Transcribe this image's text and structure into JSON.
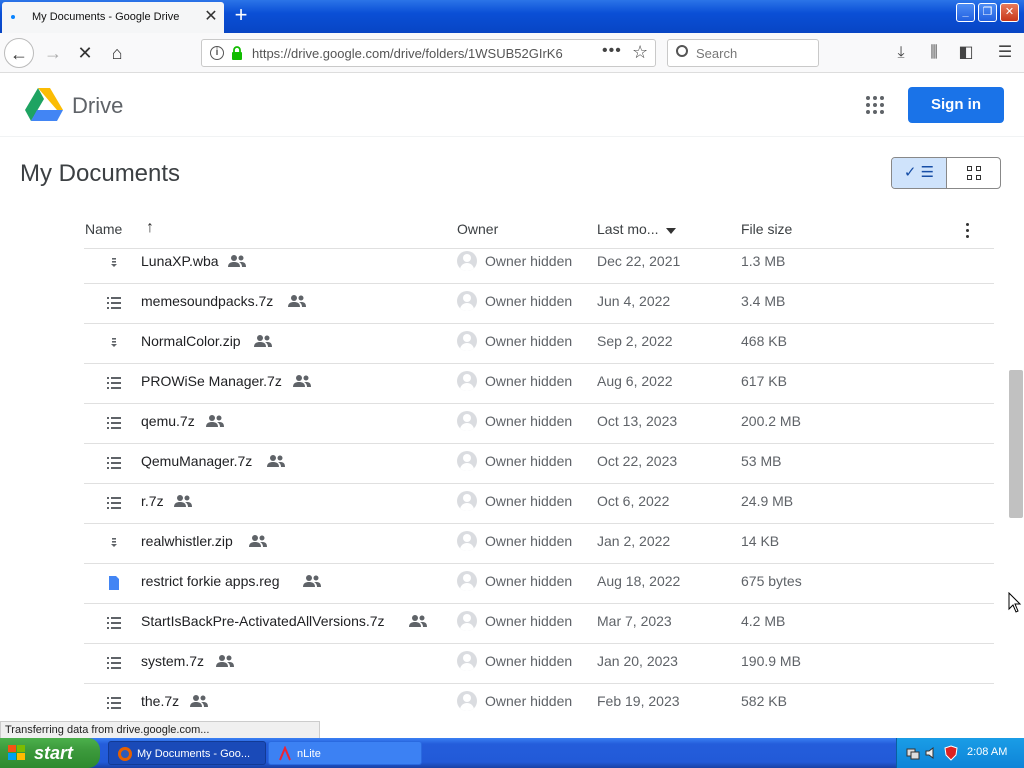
{
  "browser": {
    "tab_title": "My Documents - Google Drive",
    "url": "https://drive.google.com/drive/folders/1WSUB52GIrK6",
    "search_placeholder": "Search",
    "status_text": "Transferring data from drive.google.com..."
  },
  "drive": {
    "product_name": "Drive",
    "signin_label": "Sign in",
    "page_title": "My Documents",
    "columns": {
      "name": "Name",
      "owner": "Owner",
      "modified": "Last mo...",
      "size": "File size"
    },
    "files": [
      {
        "name": "LunaXP.wba",
        "icon": "archive-icon",
        "owner": "Owner hidden",
        "date": "Dec 22, 2021",
        "size": "1.3 MB"
      },
      {
        "name": "memesoundpacks.7z",
        "icon": "list-icon",
        "owner": "Owner hidden",
        "date": "Jun 4, 2022",
        "size": "3.4 MB"
      },
      {
        "name": "NormalColor.zip",
        "icon": "archive-icon",
        "owner": "Owner hidden",
        "date": "Sep 2, 2022",
        "size": "468 KB"
      },
      {
        "name": "PROWiSe Manager.7z",
        "icon": "list-icon",
        "owner": "Owner hidden",
        "date": "Aug 6, 2022",
        "size": "617 KB"
      },
      {
        "name": "qemu.7z",
        "icon": "list-icon",
        "owner": "Owner hidden",
        "date": "Oct 13, 2023",
        "size": "200.2 MB"
      },
      {
        "name": "QemuManager.7z",
        "icon": "list-icon",
        "owner": "Owner hidden",
        "date": "Oct 22, 2023",
        "size": "53 MB"
      },
      {
        "name": "r.7z",
        "icon": "list-icon",
        "owner": "Owner hidden",
        "date": "Oct 6, 2022",
        "size": "24.9 MB"
      },
      {
        "name": "realwhistler.zip",
        "icon": "archive-icon",
        "owner": "Owner hidden",
        "date": "Jan 2, 2022",
        "size": "14 KB"
      },
      {
        "name": "restrict forkie apps.reg",
        "icon": "doc-icon",
        "owner": "Owner hidden",
        "date": "Aug 18, 2022",
        "size": "675 bytes"
      },
      {
        "name": "StartIsBackPre-ActivatedAllVersions.7z",
        "icon": "list-icon",
        "owner": "Owner hidden",
        "date": "Mar 7, 2023",
        "size": "4.2 MB"
      },
      {
        "name": "system.7z",
        "icon": "list-icon",
        "owner": "Owner hidden",
        "date": "Jan 20, 2023",
        "size": "190.9 MB"
      },
      {
        "name": "the.7z",
        "icon": "list-icon",
        "owner": "Owner hidden",
        "date": "Feb 19, 2023",
        "size": "582 KB"
      }
    ]
  },
  "taskbar": {
    "start_label": "start",
    "tasks": [
      "My Documents - Goo...",
      "nLite"
    ],
    "clock": "2:08 AM"
  },
  "colors": {
    "accent": "#1a73e8",
    "file_doc": "#4285f4"
  }
}
